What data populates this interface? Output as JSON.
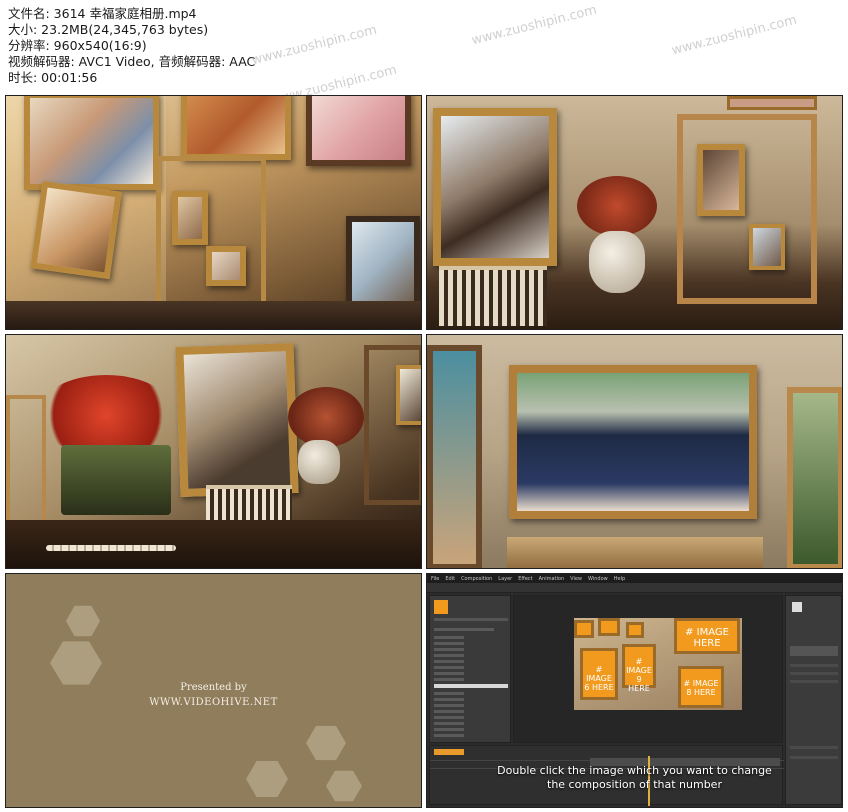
{
  "file_info": {
    "filename": "文件名: 3614 幸福家庭相册.mp4",
    "size": "大小: 23.2MB(24,345,763 bytes)",
    "resolution": "分辨率: 960x540(16:9)",
    "codec": "视频解码器: AVC1 Video, 音频解码器: AAC",
    "duration": "时长: 00:01:56"
  },
  "watermark": "www.zuoshipin.com",
  "frames": {
    "presented_by": "Presented by",
    "presented_site": "WWW.VIDEOHIVE.NET"
  },
  "ae": {
    "menus": [
      "File",
      "Edit",
      "Composition",
      "Layer",
      "Effect",
      "Animation",
      "View",
      "Window",
      "Help"
    ],
    "tiles": [
      "# IMAGE 6 HERE",
      "# IMAGE HERE",
      "# IMAGE 9 HERE",
      "# IMAGE 8 HERE"
    ],
    "caption_line1": "Double click the image which you want to change",
    "caption_line2": "the composition of that number"
  }
}
